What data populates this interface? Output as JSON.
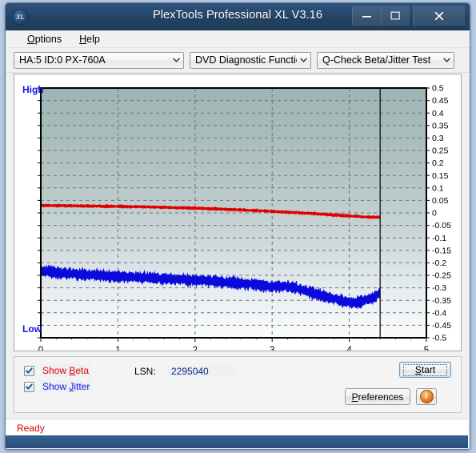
{
  "window": {
    "title": "PlexTools Professional XL V3.16",
    "app_icon": "XL",
    "icon_name": "plextools-xl-icon",
    "buttons": {
      "minimize": "minimize-icon",
      "maximize": "maximize-icon",
      "close": "close-icon"
    }
  },
  "menubar": {
    "items": [
      {
        "label": "Options",
        "accel": "O"
      },
      {
        "label": "Help",
        "accel": "H"
      }
    ]
  },
  "toolbar": {
    "drive": "HA:5 ID:0  PX-760A",
    "function": "DVD Diagnostic Functions",
    "test": "Q-Check Beta/Jitter Test",
    "chevron": "chevron-down-icon"
  },
  "chart_labels": {
    "high": "High",
    "low": "Low"
  },
  "controls": {
    "show_beta": {
      "label_pre": "Show ",
      "accel": "B",
      "label_post": "eta",
      "checked": true,
      "color": "#e00000"
    },
    "show_jitter": {
      "label_pre": "Show ",
      "accel": "J",
      "label_post": "itter",
      "checked": true,
      "color": "#1414e0"
    },
    "lsn_label": "LSN:",
    "lsn_value": "2295040",
    "start": {
      "accel": "S",
      "label_pre": "",
      "label_post": "tart"
    },
    "preferences": {
      "accel": "P",
      "label_pre": "",
      "label_post": "references"
    },
    "info": "info-icon"
  },
  "statusbar": {
    "text": "Ready",
    "color": "#d40000"
  },
  "chart_data": {
    "type": "line",
    "title": "Q-Check Beta/Jitter Test",
    "xlabel": "",
    "ylabel": "",
    "xlim": [
      0,
      5
    ],
    "ylim": [
      -0.5,
      0.5
    ],
    "xticks": [
      0,
      1,
      2,
      3,
      4,
      5
    ],
    "yticks": [
      0.5,
      0.45,
      0.4,
      0.35,
      0.3,
      0.25,
      0.2,
      0.15,
      0.1,
      0.05,
      0,
      -0.05,
      -0.1,
      -0.15,
      -0.2,
      -0.25,
      -0.3,
      -0.35,
      -0.4,
      -0.45,
      -0.5
    ],
    "ytick_labels": [
      "0.5",
      "0.45",
      "0.4",
      "0.35",
      "0.3",
      "0.25",
      "0.2",
      "0.15",
      "0.1",
      "0.05",
      "0",
      "-0.05",
      "-0.1",
      "-0.15",
      "-0.2",
      "-0.25",
      "-0.3",
      "-0.35",
      "-0.4",
      "-0.45",
      "-0.5"
    ],
    "grid": true,
    "legend": "none",
    "data_end_x": 4.4,
    "cursor_x": 4.4,
    "axis_side_labels": {
      "top": "High",
      "bottom": "Low"
    },
    "series": [
      {
        "name": "Beta",
        "color": "#e00000",
        "noise": 0.008,
        "x": [
          0.0,
          0.25,
          0.5,
          0.75,
          1.0,
          1.25,
          1.5,
          1.75,
          2.0,
          2.25,
          2.5,
          2.75,
          3.0,
          3.25,
          3.5,
          3.75,
          4.0,
          4.2,
          4.4
        ],
        "values": [
          0.03,
          0.029,
          0.028,
          0.027,
          0.026,
          0.025,
          0.023,
          0.021,
          0.019,
          0.016,
          0.013,
          0.01,
          0.006,
          0.002,
          -0.002,
          -0.007,
          -0.012,
          -0.016,
          -0.018
        ]
      },
      {
        "name": "Jitter",
        "color": "#0a0adc",
        "noise": 0.03,
        "x": [
          0.0,
          0.25,
          0.5,
          0.75,
          1.0,
          1.25,
          1.5,
          1.75,
          2.0,
          2.25,
          2.5,
          2.75,
          3.0,
          3.15,
          3.3,
          3.5,
          3.7,
          3.9,
          4.05,
          4.2,
          4.32,
          4.4
        ],
        "values": [
          -0.232,
          -0.241,
          -0.246,
          -0.25,
          -0.254,
          -0.258,
          -0.262,
          -0.266,
          -0.27,
          -0.274,
          -0.279,
          -0.286,
          -0.296,
          -0.292,
          -0.3,
          -0.318,
          -0.336,
          -0.352,
          -0.36,
          -0.352,
          -0.338,
          -0.318
        ]
      }
    ]
  }
}
